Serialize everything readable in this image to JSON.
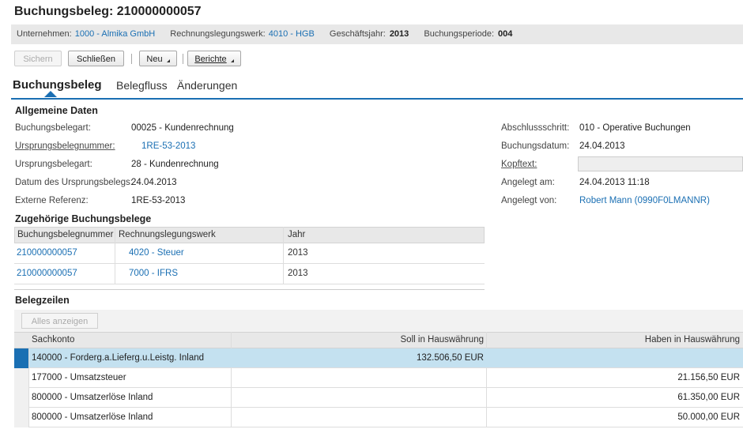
{
  "title": "Buchungsbeleg: 210000000057",
  "context": {
    "unternehmen_label": "Unternehmen:",
    "unternehmen_value": "1000 - Almika GmbH",
    "rlw_label": "Rechnungslegungswerk:",
    "rlw_value": "4010 - HGB",
    "gj_label": "Geschäftsjahr:",
    "gj_value": "2013",
    "periode_label": "Buchungsperiode:",
    "periode_value": "004"
  },
  "toolbar": {
    "sichern": "Sichern",
    "schliessen": "Schließen",
    "neu": "Neu",
    "berichte": "Berichte"
  },
  "tabs": [
    "Buchungsbeleg",
    "Belegfluss",
    "Änderungen"
  ],
  "general": {
    "heading": "Allgemeine Daten",
    "left": [
      {
        "label": "Buchungsbelegart:",
        "value": "00025 - Kundenrechnung"
      },
      {
        "label": "Ursprungsbelegnummer:",
        "value": "1RE-53-2013"
      },
      {
        "label": "Ursprungsbelegart:",
        "value": "28 - Kundenrechnung"
      },
      {
        "label": "Datum des Ursprungsbelegs:",
        "value": "24.04.2013"
      },
      {
        "label": "Externe Referenz:",
        "value": "1RE-53-2013"
      }
    ],
    "right": [
      {
        "label": "Abschlussschritt:",
        "value": "010 - Operative Buchungen"
      },
      {
        "label": "Buchungsdatum:",
        "value": "24.04.2013"
      },
      {
        "label": "Kopftext:",
        "value": ""
      },
      {
        "label": "Angelegt am:",
        "value": "24.04.2013 11:18"
      },
      {
        "label": "Angelegt von:",
        "value": "Robert Mann (0990F0LMANNR)"
      }
    ]
  },
  "related": {
    "heading": "Zugehörige Buchungsbelege",
    "columns": [
      "Buchungsbelegnummer",
      "Rechnungslegungswerk",
      "Jahr"
    ],
    "rows": [
      [
        "210000000057",
        "4020 - Steuer",
        "2013"
      ],
      [
        "210000000057",
        "7000 - IFRS",
        "2013"
      ]
    ]
  },
  "lines": {
    "heading": "Belegzeilen",
    "show_all": "Alles anzeigen",
    "columns": [
      "Sachkonto",
      "Soll in Hauswährung",
      "Haben in Hauswährung"
    ],
    "rows": [
      [
        "140000 - Forderg.a.Lieferg.u.Leistg. Inland",
        "132.506,50 EUR",
        ""
      ],
      [
        "177000 - Umsatzsteuer",
        "",
        "21.156,50 EUR"
      ],
      [
        "800000 - Umsatzerlöse Inland",
        "",
        "61.350,00 EUR"
      ],
      [
        "800000 - Umsatzerlöse Inland",
        "",
        "50.000,00 EUR"
      ]
    ]
  },
  "colors": {
    "accent": "#1a6fb3",
    "selected_row": "#c4e1f0",
    "header_bg": "#e8e8e8"
  }
}
